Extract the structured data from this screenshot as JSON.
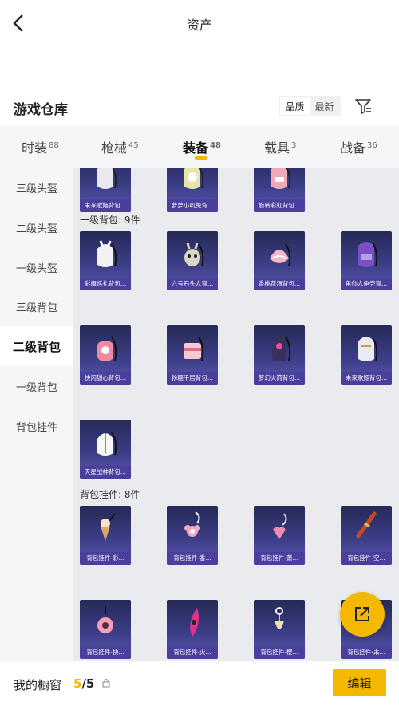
{
  "header": {
    "title": "资产"
  },
  "warehouse": {
    "title": "游戏仓库",
    "sort_quality": "品质",
    "sort_latest": "最新"
  },
  "tabs": [
    {
      "label": "时装",
      "count": "88"
    },
    {
      "label": "枪械",
      "count": "45"
    },
    {
      "label": "装备",
      "count": "48"
    },
    {
      "label": "载具",
      "count": "3"
    },
    {
      "label": "战备",
      "count": "36"
    }
  ],
  "sidebar": [
    {
      "label": "三级头盔"
    },
    {
      "label": "二级头盔"
    },
    {
      "label": "一级头盔"
    },
    {
      "label": "三级背包"
    },
    {
      "label": "二级背包"
    },
    {
      "label": "一级背包"
    },
    {
      "label": "背包挂件"
    }
  ],
  "top_row": [
    "未来歌姬背包...",
    "萝萝小叽兔背...",
    "旋转彩虹背包..."
  ],
  "section_lv1": {
    "label": "一级背包: 9件",
    "items": [
      "彩旗巡礼背包...",
      "六号石头人背...",
      "香桃花海背包...",
      "龟仙人龟壳背...",
      "快闪甜心背包...",
      "粉糖千层背包...",
      "梦幻火箭背包...",
      "未来歌姬背包...",
      "天星战神背包..."
    ]
  },
  "section_pendant": {
    "label": "背包挂件: 8件",
    "items": [
      "背包挂件-彩...",
      "背包挂件-香...",
      "背包挂件-萧...",
      "背包挂件-空...",
      "背包挂件-快...",
      "背包挂件-火...",
      "背包挂件-樱...",
      "背包挂件-未..."
    ]
  },
  "bottom": {
    "cabinet_label": "我的橱窗",
    "current": "5",
    "total": "/5",
    "edit_label": "编辑"
  },
  "colors": {
    "accent": "#f5b800",
    "card_bg": "#2e3170"
  }
}
